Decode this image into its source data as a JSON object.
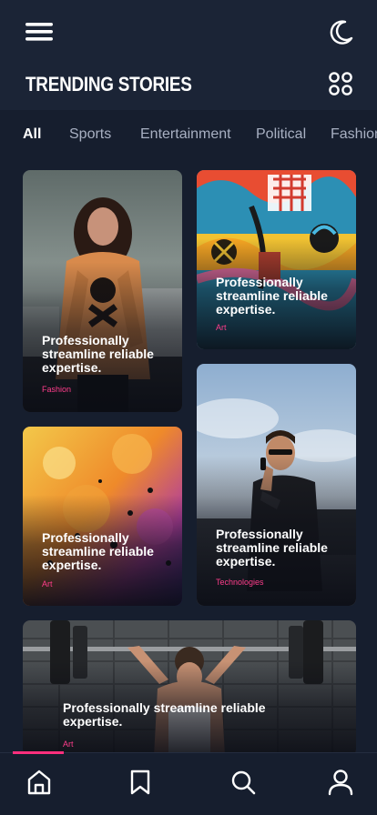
{
  "header": {
    "title": "TRENDING STORIES",
    "icons": {
      "menu": "hamburger-menu-icon",
      "theme": "moon-icon",
      "layout": "grid-view-icon"
    }
  },
  "tabs": [
    {
      "label": "All",
      "active": true
    },
    {
      "label": "Sports",
      "active": false
    },
    {
      "label": "Entertainment",
      "active": false
    },
    {
      "label": "Political",
      "active": false
    },
    {
      "label": "Fashion",
      "active": false
    }
  ],
  "cards": [
    {
      "title": "Professionally streamline reliable expertise.",
      "category": "Fashion",
      "image": "woman in orange hoodie"
    },
    {
      "title": "Professionally streamline reliable expertise.",
      "category": "Art",
      "image": "colorful graffiti wall"
    },
    {
      "title": "Professionally streamline reliable expertise.",
      "category": "Art",
      "image": "abstract paint texture"
    },
    {
      "title": "Professionally streamline reliable expertise.",
      "category": "Technologies",
      "image": "man on phone"
    },
    {
      "title": "Professionally streamline reliable expertise.",
      "category": "Art",
      "image": "woman lifting barbell"
    }
  ],
  "bottom_nav": [
    {
      "name": "home",
      "icon": "home-icon",
      "active": true
    },
    {
      "name": "bookmarks",
      "icon": "bookmark-icon",
      "active": false
    },
    {
      "name": "search",
      "icon": "search-icon",
      "active": false
    },
    {
      "name": "profile",
      "icon": "user-icon",
      "active": false
    }
  ],
  "colors": {
    "background": "#161e2e",
    "header": "#1b2436",
    "accent": "#ff2f7d",
    "category": "#ff3d8b"
  }
}
